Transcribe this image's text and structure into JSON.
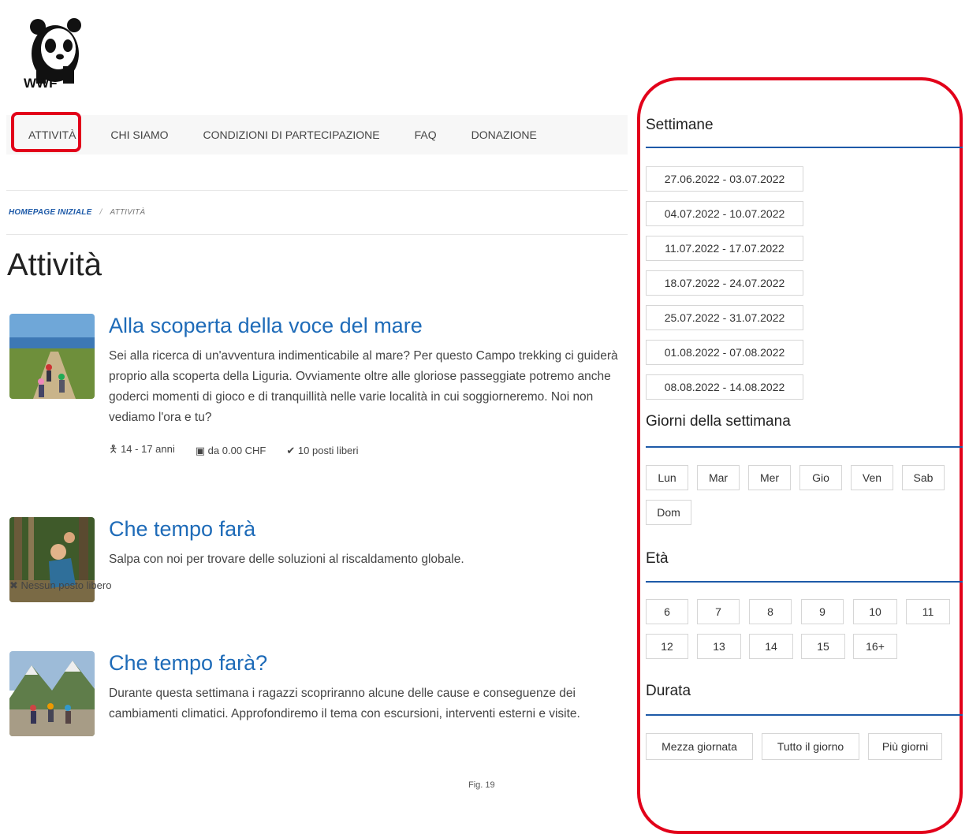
{
  "brand": {
    "logo_text": "WWF"
  },
  "nav": {
    "items": [
      "ATTIVITÀ",
      "CHI SIAMO",
      "CONDIZIONI DI PARTECIPAZIONE",
      "FAQ",
      "DONAZIONE"
    ]
  },
  "breadcrumb": {
    "home": "HOMEPAGE INIZIALE",
    "separator": "/",
    "current": "ATTIVITÀ"
  },
  "page": {
    "title": "Attività"
  },
  "activities": [
    {
      "title": "Alla scoperta della voce del mare",
      "description": "Sei alla ricerca di un'avventura indimenticabile al mare? Per questo Campo trekking ci guiderà proprio alla scoperta della Liguria. Ovviamente oltre alle gloriose passeggiate potremo anche goderci momenti di gioco e di tranquillità nelle varie località in cui soggiorneremo. Noi non vediamo l'ora e tu?",
      "age": "14 - 17 anni",
      "price": "da 0.00 CHF",
      "seats": "10 posti liberi"
    },
    {
      "title": "Che tempo farà",
      "description": "Salpa con noi per trovare delle soluzioni al riscaldamento globale.",
      "seats": "Nessun posto libero"
    },
    {
      "title": "Che tempo farà?",
      "description": "Durante questa settimana i ragazzi scopriranno alcune delle cause e conseguenze dei cambiamenti climatici. Approfondiremo il tema con escursioni, interventi esterni e visite."
    }
  ],
  "filters": {
    "weeks": {
      "heading": "Settimane",
      "options": [
        "27.06.2022 - 03.07.2022",
        "04.07.2022 - 10.07.2022",
        "11.07.2022 - 17.07.2022",
        "18.07.2022 - 24.07.2022",
        "25.07.2022 - 31.07.2022",
        "01.08.2022 - 07.08.2022",
        "08.08.2022 - 14.08.2022"
      ]
    },
    "days": {
      "heading": "Giorni della settimana",
      "options": [
        "Lun",
        "Mar",
        "Mer",
        "Gio",
        "Ven",
        "Sab",
        "Dom"
      ]
    },
    "age": {
      "heading": "Età",
      "options": [
        "6",
        "7",
        "8",
        "9",
        "10",
        "11",
        "12",
        "13",
        "14",
        "15",
        "16+"
      ]
    },
    "duration": {
      "heading": "Durata",
      "options": [
        "Mezza giornata",
        "Tutto il giorno",
        "Più giorni"
      ]
    }
  },
  "caption": "Fig. 19",
  "colors": {
    "accent_red": "#e2001a",
    "link_blue": "#1e6bb8",
    "rule_blue": "#1e5aa8"
  }
}
